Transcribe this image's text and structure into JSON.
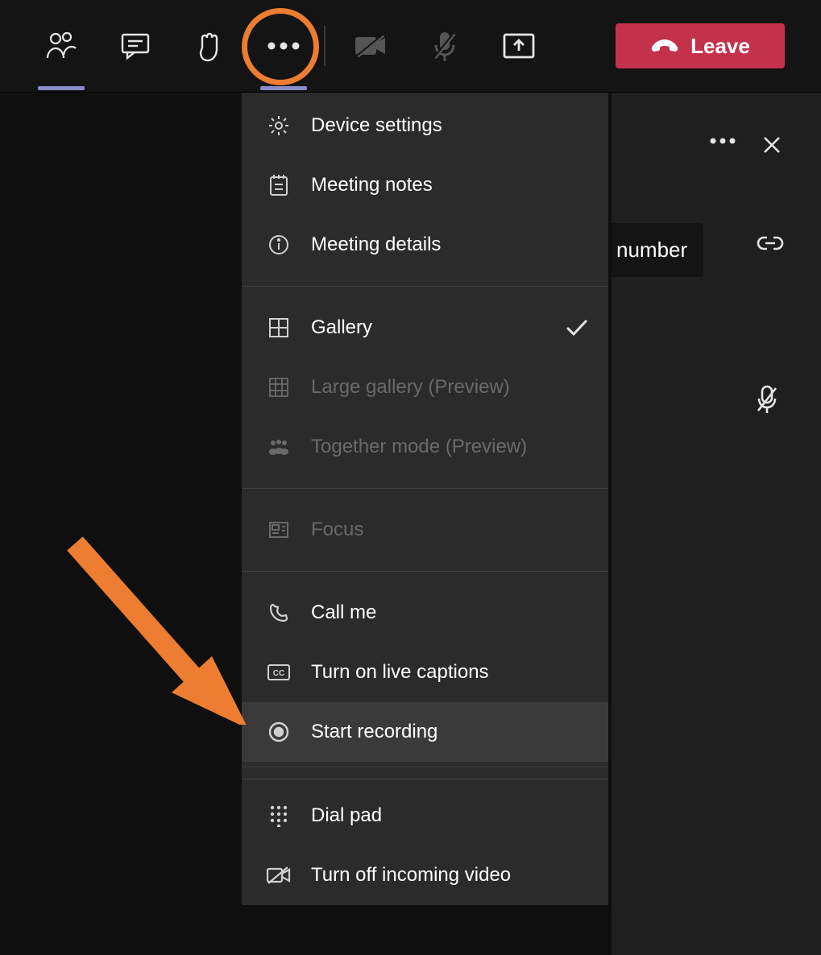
{
  "toolbar": {
    "leave_label": "Leave"
  },
  "menu": {
    "device_settings": "Device settings",
    "meeting_notes": "Meeting notes",
    "meeting_details": "Meeting details",
    "gallery": "Gallery",
    "large_gallery": "Large gallery (Preview)",
    "together_mode": "Together mode (Preview)",
    "focus": "Focus",
    "call_me": "Call me",
    "live_captions": "Turn on live captions",
    "start_recording": "Start recording",
    "dial_pad": "Dial pad",
    "turn_off_incoming_video": "Turn off incoming video"
  },
  "panel": {
    "number_label": "number"
  },
  "colors": {
    "leave_bg": "#c4314b",
    "highlight": "#ed7d31",
    "underline": "#8b8cc7"
  }
}
